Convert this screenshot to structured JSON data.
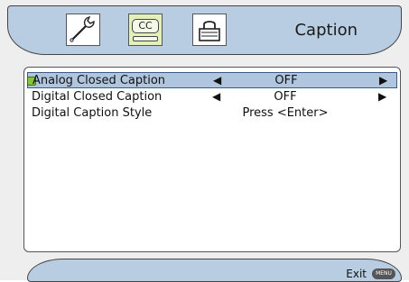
{
  "header": {
    "title": "Caption",
    "tabs": [
      {
        "icon": "wrench-icon"
      },
      {
        "icon": "closed-caption-icon",
        "label": "CC",
        "active": true
      },
      {
        "icon": "lock-icon"
      }
    ]
  },
  "menu": {
    "items": [
      {
        "label": "Analog Closed Caption",
        "value": "OFF",
        "selected": true
      },
      {
        "label": "Digital Closed Caption",
        "value": "OFF"
      },
      {
        "label": "Digital Caption Style",
        "value": "Press <Enter>"
      }
    ]
  },
  "footer": {
    "exit_label": "Exit",
    "menu_button_label": "MENU"
  },
  "colors": {
    "header_bg": "#b9cde2",
    "selected_row_bg": "#afc6de",
    "active_tab_bg": "#e3f0b7",
    "bullet": "#86c43d"
  }
}
